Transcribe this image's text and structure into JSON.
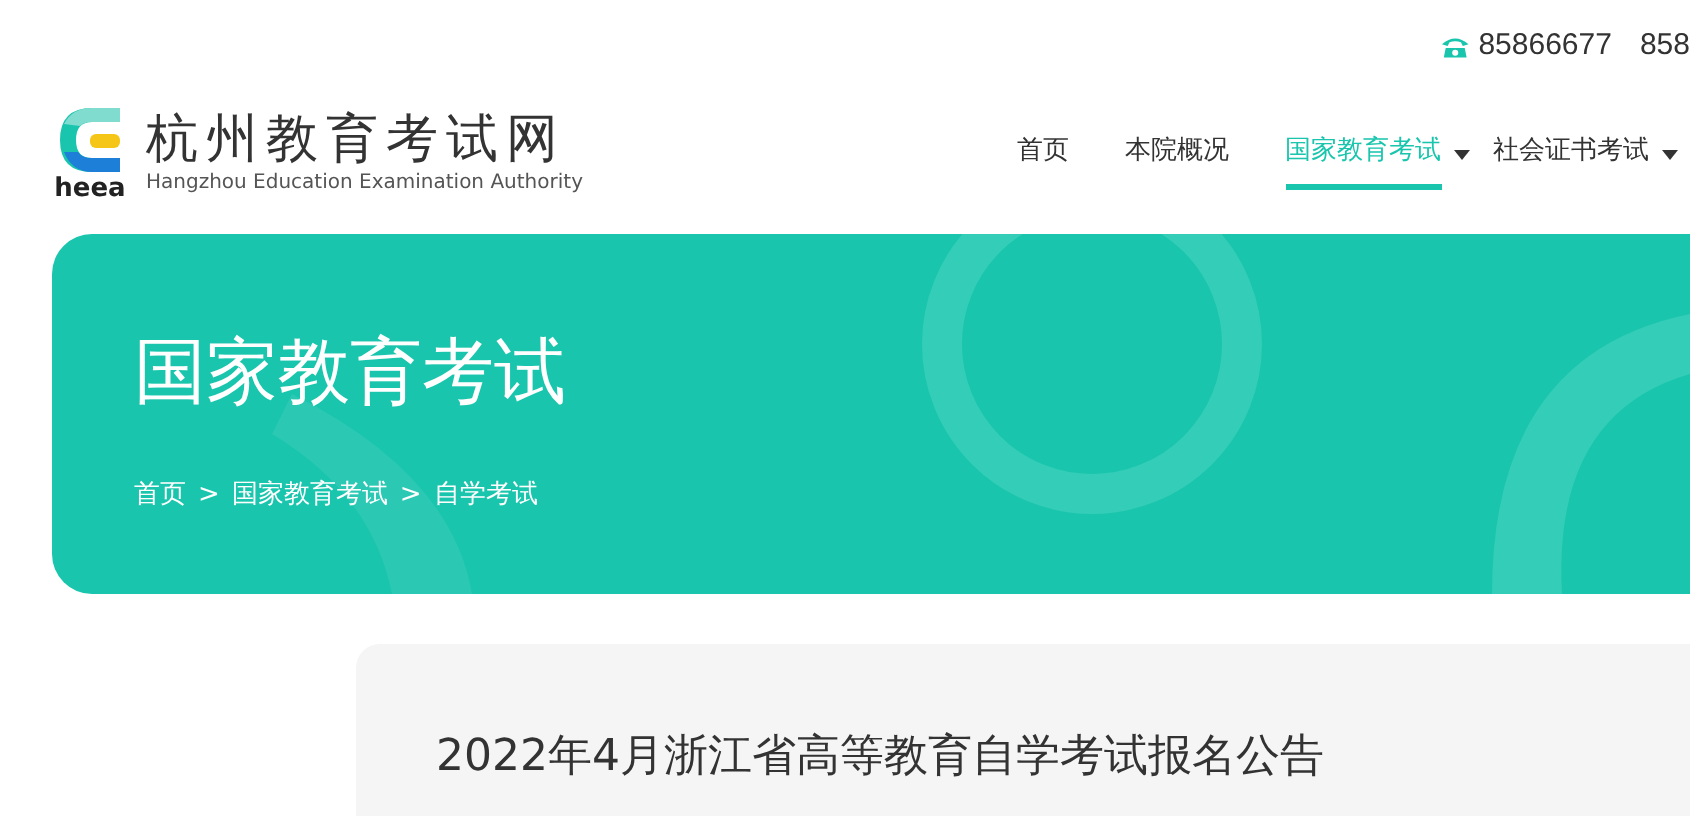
{
  "top_bar": {
    "phones": [
      "85866677",
      "858"
    ]
  },
  "logo": {
    "mark": "heea",
    "title": "杭州教育考试网",
    "subtitle": "Hangzhou Education Examination Authority"
  },
  "nav": [
    {
      "label": "首页",
      "selected": false,
      "dropdown": false
    },
    {
      "label": "本院概况",
      "selected": false,
      "dropdown": false
    },
    {
      "label": "国家教育考试",
      "selected": true,
      "dropdown": true
    },
    {
      "label": "社会证书考试",
      "selected": false,
      "dropdown": true
    }
  ],
  "banner": {
    "title": "国家教育考试",
    "breadcrumb": [
      "首页",
      "国家教育考试",
      "自学考试"
    ],
    "separator": ">"
  },
  "article": {
    "title": "2022年4月浙江省高等教育自学考试报名公告"
  }
}
